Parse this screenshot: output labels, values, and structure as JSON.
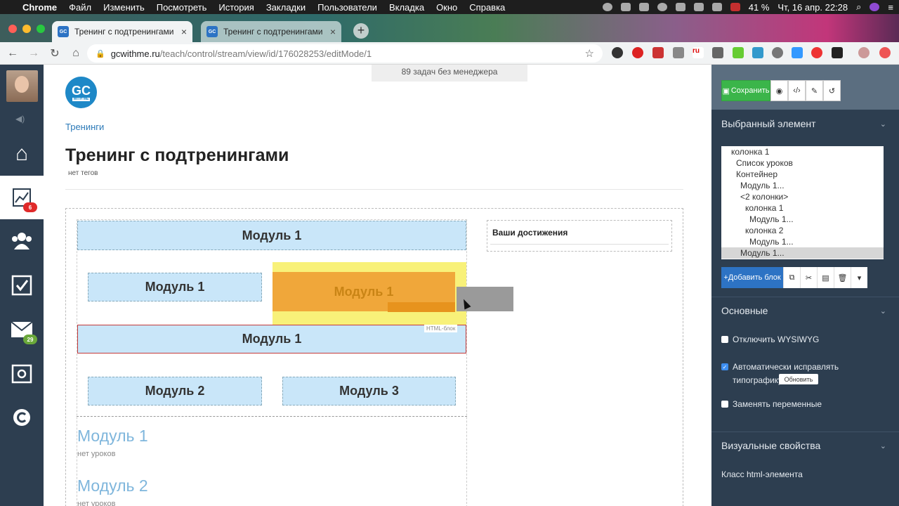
{
  "os_menubar": {
    "app": "Chrome",
    "items": [
      "Файл",
      "Изменить",
      "Посмотреть",
      "История",
      "Закладки",
      "Пользователи",
      "Вкладка",
      "Окно",
      "Справка"
    ],
    "battery": "41 %",
    "clock": "Чт, 16 апр. 22:28"
  },
  "browser": {
    "tabs": [
      {
        "title": "Тренинг с подтренингами",
        "favicon": "GC",
        "active": true
      },
      {
        "title": "Тренинг с подтренингами",
        "favicon": "GC",
        "active": false
      }
    ],
    "url_host": "gcwithme.ru",
    "url_path": "/teach/control/stream/view/id/176028253/editMode/1"
  },
  "rail": {
    "badges": {
      "stats": "6",
      "mail": "29"
    },
    "icons": [
      "home-icon",
      "chart-icon",
      "users-icon",
      "tasks-icon",
      "mail-icon",
      "safe-icon",
      "chat-icon"
    ]
  },
  "page": {
    "tasks_banner": "89 задач без менеджера",
    "logo_text": "GC",
    "logo_sub": "WITH ME",
    "breadcrumb": "Тренинги",
    "title": "Тренинг с подтренингами",
    "tags": "нет тегов",
    "blocks": {
      "top": "Модуль 1",
      "row1_left": "Модуль 1",
      "dragging": "Модуль 1",
      "selected": "Модуль 1",
      "selected_tag": "HTML-блок",
      "row3_left": "Модуль 2",
      "row3_right": "Модуль 3"
    },
    "achievements": "Ваши достижения",
    "lessons": [
      {
        "title": "Модуль 1",
        "sub": "нет уроков"
      },
      {
        "title": "Модуль 2",
        "sub": "нет уроков"
      }
    ]
  },
  "panel": {
    "save_label": "Сохранить",
    "selected_element_header": "Выбранный элемент",
    "tree": [
      {
        "label": "колонка 1",
        "depth": 0
      },
      {
        "label": "Список уроков",
        "depth": 1
      },
      {
        "label": "Контейнер",
        "depth": 1
      },
      {
        "label": "Модуль 1...",
        "depth": 2
      },
      {
        "label": "<2 колонки>",
        "depth": 2
      },
      {
        "label": "колонка 1",
        "depth": 3
      },
      {
        "label": "Модуль 1...",
        "depth": 4
      },
      {
        "label": "колонка 2",
        "depth": 3
      },
      {
        "label": "Модуль 1...",
        "depth": 4
      },
      {
        "label": "Модуль 1...",
        "depth": 2,
        "selected": true
      }
    ],
    "add_block_label": "+Добавить блок",
    "basic_header": "Основные",
    "disable_wysiwyg": "Отключить WYSIWYG",
    "auto_typography": "Автоматически исправлять типографику",
    "refresh_label": "Обновить",
    "replace_vars": "Заменять переменные",
    "visual_header": "Визуальные свойства",
    "html_class_label": "Класс html-элемента"
  },
  "colors": {
    "module_bg": "#c9e6f9",
    "save_green": "#3bb54a",
    "panel_bg": "#2d3e50",
    "accent_blue": "#2d73c4"
  }
}
